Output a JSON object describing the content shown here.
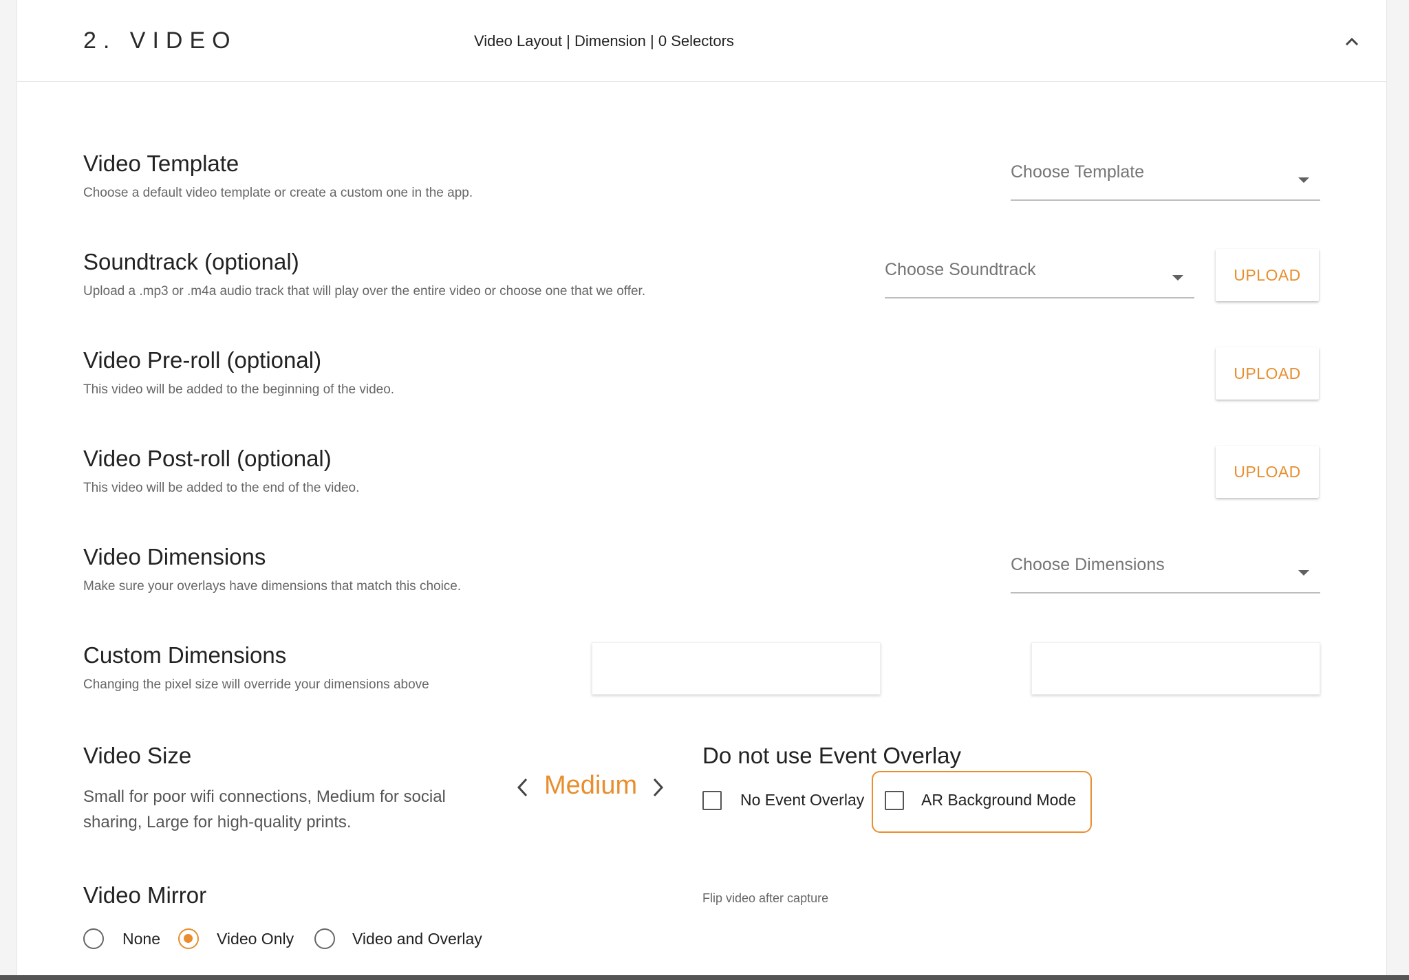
{
  "section": {
    "title": "2. VIDEO",
    "summary": "Video Layout | Dimension | 0 Selectors"
  },
  "rows": {
    "template": {
      "title": "Video Template",
      "desc": "Choose a default video template or create a custom one in the app.",
      "select_placeholder": "Choose Template"
    },
    "soundtrack": {
      "title": "Soundtrack (optional)",
      "desc": "Upload a .mp3 or .m4a audio track that will play over the entire video or choose one that we offer.",
      "select_placeholder": "Choose Soundtrack",
      "upload_label": "UPLOAD"
    },
    "preroll": {
      "title": "Video Pre-roll (optional)",
      "desc": "This video will be added to the beginning of the video.",
      "upload_label": "UPLOAD"
    },
    "postroll": {
      "title": "Video Post-roll (optional)",
      "desc": "This video will be added to the end of the video.",
      "upload_label": "UPLOAD"
    },
    "dimensions": {
      "title": "Video Dimensions",
      "desc": "Make sure your overlays have dimensions that match this choice.",
      "select_placeholder": "Choose Dimensions"
    },
    "custom_dimensions": {
      "title": "Custom Dimensions",
      "desc": "Changing the pixel size will override your dimensions above",
      "width_value": "",
      "height_value": ""
    },
    "size": {
      "title": "Video Size",
      "desc": "Small for poor wifi connections, Medium for social sharing, Large for high-quality prints.",
      "value": "Medium"
    },
    "overlay": {
      "title": "Do not use Event Overlay",
      "no_event_overlay_label": "No Event Overlay",
      "no_event_overlay_checked": false,
      "ar_background_label": "AR Background Mode",
      "ar_background_checked": false
    },
    "mirror": {
      "title": "Video Mirror",
      "desc": "Flip video after capture",
      "options": [
        "None",
        "Video Only",
        "Video and Overlay"
      ],
      "selected": "Video Only"
    }
  },
  "colors": {
    "accent": "#e88e2e",
    "text": "#222222",
    "muted": "#666666"
  },
  "icons": {
    "collapse": "chevron-up-icon",
    "prev": "chevron-left-icon",
    "next": "chevron-right-icon",
    "caret": "caret-down-icon"
  }
}
